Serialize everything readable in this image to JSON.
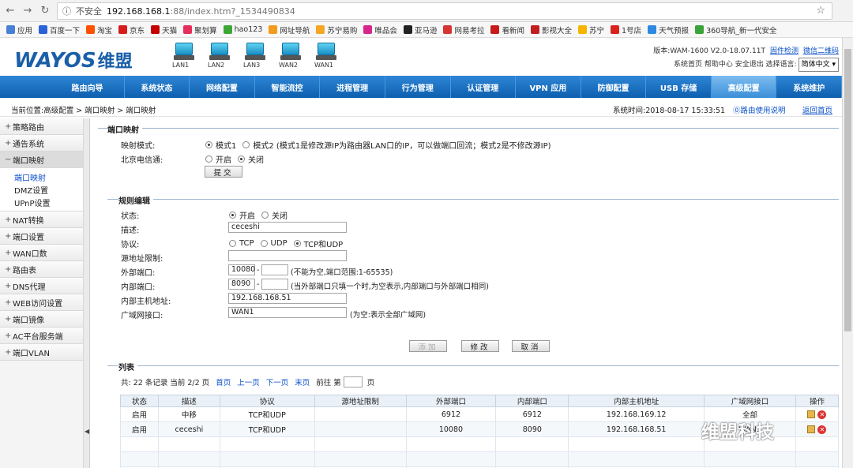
{
  "browser": {
    "insecure_label": "不安全",
    "url_host": "192.168.168.1",
    "url_rest": ":88/index.htm?_1534490834",
    "bookmarks": [
      {
        "label": "应用",
        "color": "#4a7fd6"
      },
      {
        "label": "百度一下",
        "color": "#2c62d9"
      },
      {
        "label": "淘宝",
        "color": "#ff5000"
      },
      {
        "label": "京东",
        "color": "#d71c1e"
      },
      {
        "label": "天猫",
        "color": "#c40000"
      },
      {
        "label": "聚划算",
        "color": "#e52e5b"
      },
      {
        "label": "hao123",
        "color": "#3ea734"
      },
      {
        "label": "网址导航",
        "color": "#f39b1a"
      },
      {
        "label": "苏宁易购",
        "color": "#f5a623"
      },
      {
        "label": "唯品会",
        "color": "#d9268a"
      },
      {
        "label": "亚马逊",
        "color": "#222222"
      },
      {
        "label": "网易考拉",
        "color": "#d93434"
      },
      {
        "label": "看新闻",
        "color": "#c81a1a"
      },
      {
        "label": "影视大全",
        "color": "#c11f1f"
      },
      {
        "label": "苏宁",
        "color": "#f5b400"
      },
      {
        "label": "1号店",
        "color": "#d9231f"
      },
      {
        "label": "天气预报",
        "color": "#2d8ae0"
      },
      {
        "label": "360导航_新一代安全",
        "color": "#3aa43a"
      }
    ]
  },
  "header": {
    "logo": "WAYOS",
    "logo_cn": "维盟",
    "ports": [
      "LAN1",
      "LAN2",
      "LAN3",
      "WAN2",
      "WAN1"
    ],
    "version": "版本:WAM-1600 V2.0-18.07.11T",
    "firmware_link": "固件检测",
    "wechat_link": "微信二维码",
    "links": "系统首页  帮助中心  安全退出  选择语言:",
    "language": "简体中文"
  },
  "menu": [
    "路由向导",
    "系统状态",
    "网络配置",
    "智能流控",
    "进程管理",
    "行为管理",
    "认证管理",
    "VPN 应用",
    "防御配置",
    "USB 存储",
    "高级配置",
    "系统维护"
  ],
  "menu_active": 10,
  "breadcrumb": {
    "path": "当前位置:高级配置 > 端口映射 > 端口映射",
    "time": "系统时间:2018-08-17 15:33:51",
    "help": "⓪路由使用说明",
    "home": "返回首页"
  },
  "sidebar": {
    "groups_top": [
      "策略路由",
      "通告系统"
    ],
    "open_group": "端口映射",
    "sub_items": [
      "端口映射",
      "DMZ设置",
      "UPnP设置"
    ],
    "groups_bottom": [
      "NAT转换",
      "端口设置",
      "WAN口数",
      "路由表",
      "DNS代理",
      "WEB访问设置",
      "端口镜像",
      "AC平台服务端",
      "端口VLAN"
    ]
  },
  "mapping": {
    "section": "端口映射",
    "mode_label": "映射模式:",
    "mode1": "模式1",
    "mode2": "模式2 (模式1是修改源IP为路由器LAN口的IP，可以做端口回流；模式2是不修改源IP)",
    "telecom_label": "北京电信通:",
    "on": "开启",
    "off": "关闭",
    "submit": "提交"
  },
  "rule": {
    "section": "规则编辑",
    "status_label": "状态:",
    "on": "开启",
    "off": "关闭",
    "desc_label": "描述:",
    "desc_value": "ceceshi",
    "proto_label": "协议:",
    "proto_tcp": "TCP",
    "proto_udp": "UDP",
    "proto_both": "TCP和UDP",
    "src_label": "源地址限制:",
    "ext_label": "外部端口:",
    "ext_from": "10080",
    "ext_note": "(不能为空,端口范围:1-65535)",
    "int_label": "内部端口:",
    "int_from": "8090",
    "int_note": "(当外部端口只填一个时,为空表示,内部端口与外部端口相同)",
    "host_label": "内部主机地址:",
    "host_value": "192.168.168.51",
    "wan_label": "广域网接口:",
    "wan_value": "WAN1",
    "wan_note": "(为空:表示全部广域网)",
    "add": "添加",
    "modify": "修改",
    "cancel": "取消"
  },
  "list": {
    "section": "列表",
    "summary": "共: 22 条记录 当前 2/2 页",
    "first": "首页",
    "prev": "上一页",
    "next": "下一页",
    "last": "末页",
    "goto": "前往 第",
    "page_unit": "页",
    "columns": [
      "状态",
      "描述",
      "协议",
      "源地址限制",
      "外部端口",
      "内部端口",
      "内部主机地址",
      "广域网接口",
      "操作"
    ],
    "rows": [
      [
        "启用",
        "中移",
        "TCP和UDP",
        "",
        "6912",
        "6912",
        "192.168.169.12",
        "全部"
      ],
      [
        "启用",
        "ceceshi",
        "TCP和UDP",
        "",
        "10080",
        "8090",
        "192.168.168.51",
        "WAN1"
      ]
    ]
  },
  "watermark": "维盟科技"
}
